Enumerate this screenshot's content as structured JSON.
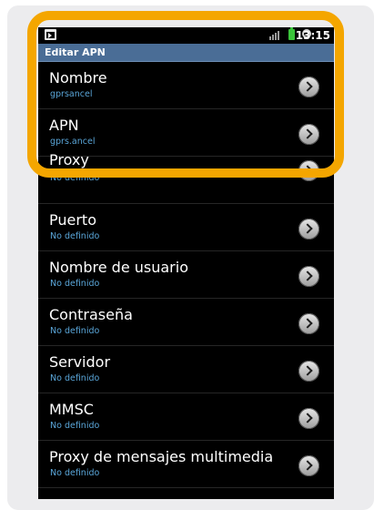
{
  "status_bar": {
    "time": "13:15",
    "icons": [
      "media-notification-icon",
      "signal-icon",
      "battery-icon",
      "alarm-icon"
    ]
  },
  "header": {
    "title": "Editar APN"
  },
  "settings": [
    {
      "label": "Nombre",
      "value": "gprsancel"
    },
    {
      "label": "APN",
      "value": "gprs.ancel"
    },
    {
      "label": "Proxy",
      "value": "No definido"
    },
    {
      "label": "Puerto",
      "value": "No definido"
    },
    {
      "label": "Nombre de usuario",
      "value": "No definido"
    },
    {
      "label": "Contraseña",
      "value": "No definido"
    },
    {
      "label": "Servidor",
      "value": "No definido"
    },
    {
      "label": "MMSC",
      "value": "No definido"
    },
    {
      "label": "Proxy de mensajes multimedia",
      "value": "No definido"
    }
  ],
  "colors": {
    "highlight": "#f4a600",
    "title_bar": "#4a6d96",
    "value_text": "#5aa6d9"
  }
}
